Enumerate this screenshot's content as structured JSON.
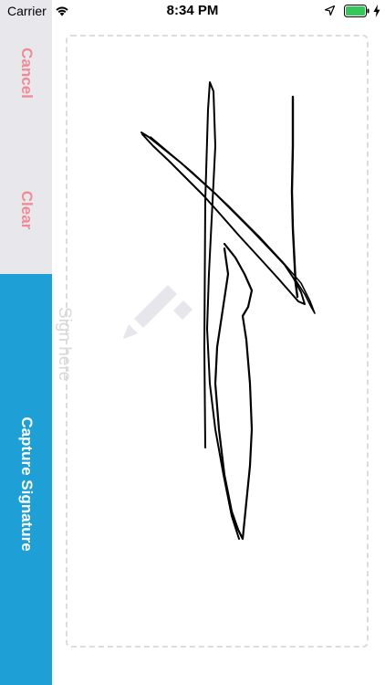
{
  "status_bar": {
    "carrier": "Carrier",
    "time": "8:34 PM",
    "icons": [
      "wifi-icon",
      "location-icon",
      "battery-icon",
      "charging-icon"
    ]
  },
  "actions": {
    "cancel_label": "Cancel",
    "clear_label": "Clear",
    "capture_label": "Capture Signature"
  },
  "signature_pad": {
    "placeholder": "Sign here",
    "placeholder_icon": "pen-icon",
    "has_signature": true
  },
  "colors": {
    "action_text": "#f08a96",
    "capture_background": "#1e9fd6",
    "side_background": "#e8e8ec",
    "placeholder": "#d8d8d8",
    "stroke": "#000000"
  }
}
